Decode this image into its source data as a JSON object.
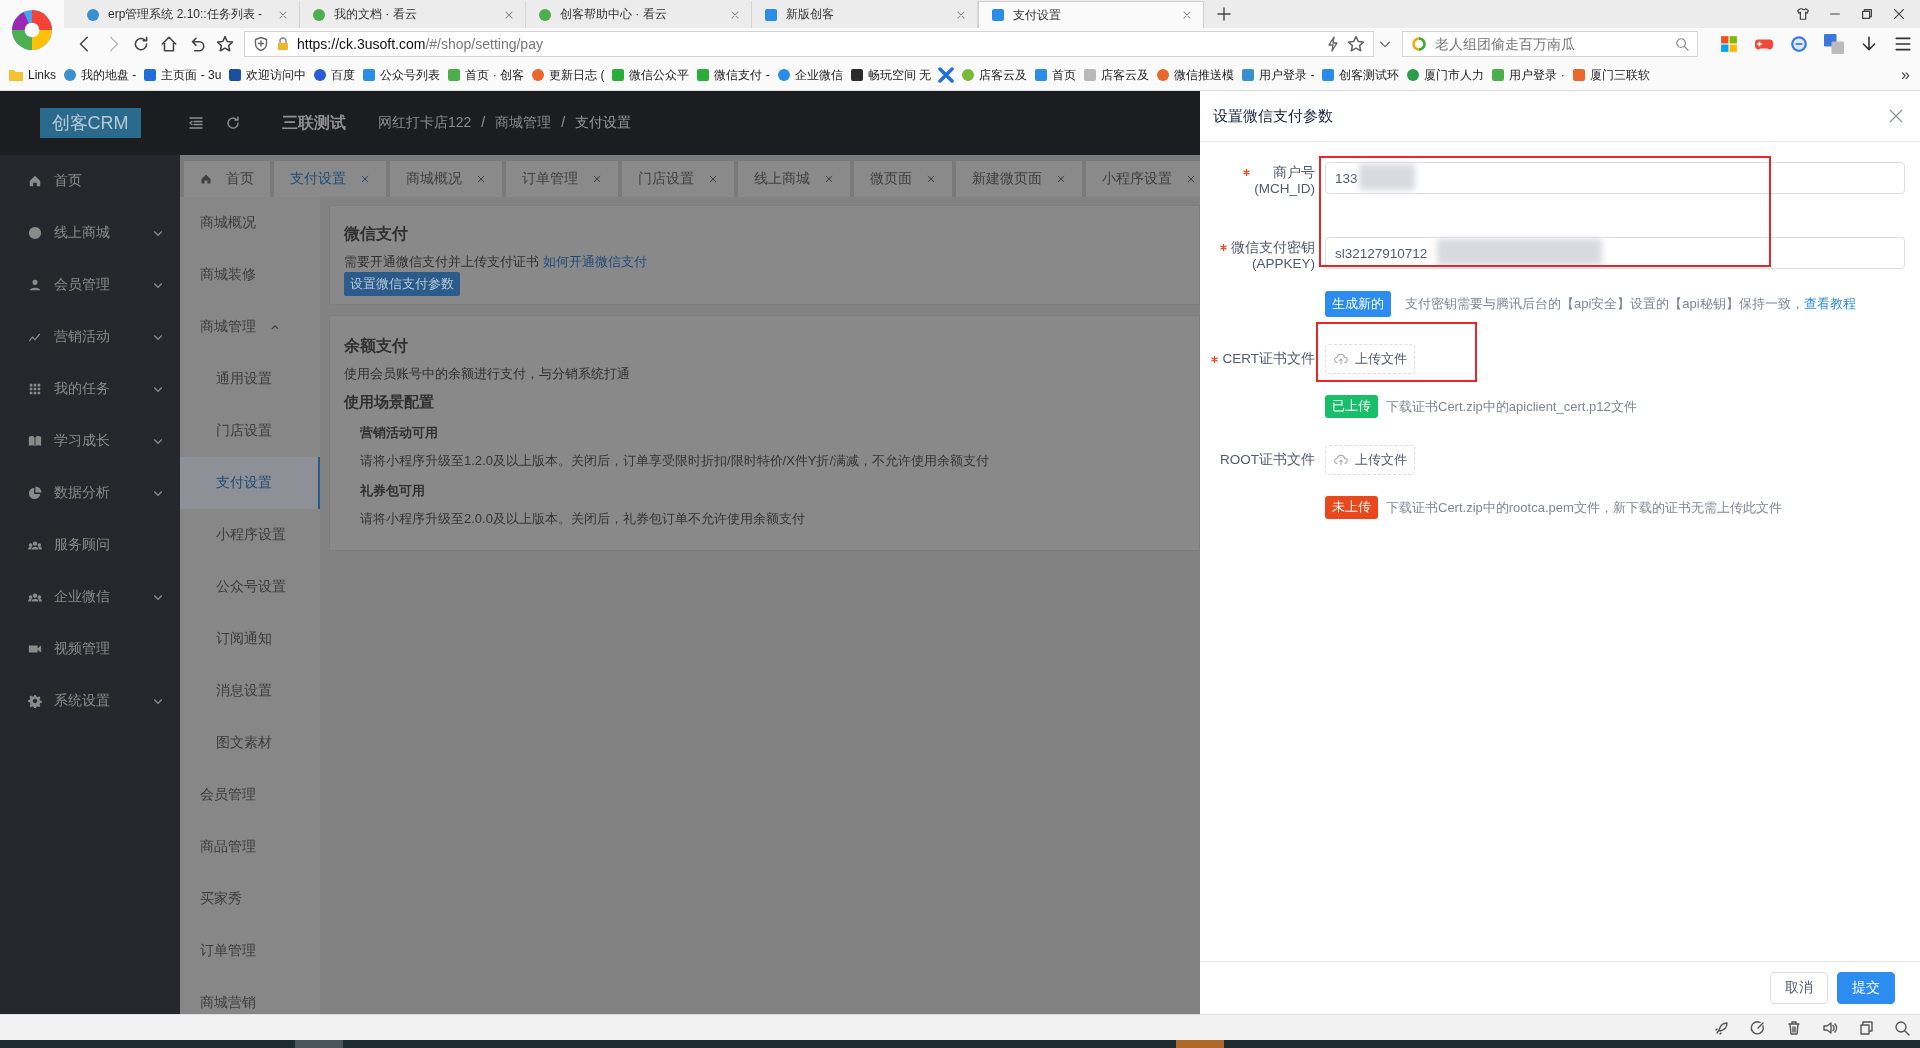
{
  "browser": {
    "tabs": [
      {
        "title": "erp管理系统 2.10::任务列表 -",
        "selected": false
      },
      {
        "title": "我的文档 · 看云",
        "selected": false
      },
      {
        "title": "创客帮助中心 · 看云",
        "selected": false
      },
      {
        "title": "新版创客",
        "selected": false
      },
      {
        "title": "支付设置",
        "selected": true
      }
    ],
    "address": {
      "host": "https://ck.3usoft.com",
      "path": "/#/shop/setting/pay"
    },
    "search": {
      "placeholder": "老人组团偷走百万南瓜"
    },
    "bookmarks": [
      {
        "kind": "folder",
        "title": "Links"
      },
      {
        "kind": "link",
        "title": "我的地盘 -"
      },
      {
        "kind": "link",
        "title": "主页面 - 3u"
      },
      {
        "kind": "link",
        "title": "欢迎访问中"
      },
      {
        "kind": "link",
        "title": "百度"
      },
      {
        "kind": "link",
        "title": "公众号列表"
      },
      {
        "kind": "link",
        "title": "首页 · 创客"
      },
      {
        "kind": "link",
        "title": "更新日志 ("
      },
      {
        "kind": "link",
        "title": "微信公众平"
      },
      {
        "kind": "link",
        "title": "微信支付 -"
      },
      {
        "kind": "link",
        "title": "企业微信"
      },
      {
        "kind": "link",
        "title": "畅玩空间 无"
      },
      {
        "kind": "icon_only"
      },
      {
        "kind": "link",
        "title": "店客云及"
      },
      {
        "kind": "link",
        "title": "首页"
      },
      {
        "kind": "link",
        "title": "店客云及"
      },
      {
        "kind": "link",
        "title": "微信推送模"
      },
      {
        "kind": "link",
        "title": "用户登录 -"
      },
      {
        "kind": "link",
        "title": "创客测试环"
      },
      {
        "kind": "link",
        "title": "厦门市人力"
      },
      {
        "kind": "link",
        "title": "用户登录 ·"
      },
      {
        "kind": "link",
        "title": "厦门三联软"
      }
    ],
    "more": "»"
  },
  "app": {
    "logo": "创客CRM",
    "store": "三联测试",
    "breadcrumb": [
      "网红打卡店122",
      "商城管理",
      "支付设置"
    ],
    "breadcrumb_separator": "/",
    "sidebar": [
      {
        "label": "首页",
        "kind": "link"
      },
      {
        "label": "线上商城",
        "kind": "group"
      },
      {
        "label": "会员管理",
        "kind": "group"
      },
      {
        "label": "营销活动",
        "kind": "group"
      },
      {
        "label": "我的任务",
        "kind": "group"
      },
      {
        "label": "学习成长",
        "kind": "group"
      },
      {
        "label": "数据分析",
        "kind": "group"
      },
      {
        "label": "服务顾问",
        "kind": "link"
      },
      {
        "label": "企业微信",
        "kind": "group"
      },
      {
        "label": "视频管理",
        "kind": "link"
      },
      {
        "label": "系统设置",
        "kind": "group"
      }
    ],
    "page_tabs": [
      {
        "label": "首页",
        "kind": "home",
        "selected": false
      },
      {
        "label": "支付设置",
        "kind": "closable",
        "selected": true
      },
      {
        "label": "商城概况",
        "kind": "closable",
        "selected": false
      },
      {
        "label": "订单管理",
        "kind": "closable",
        "selected": false
      },
      {
        "label": "门店设置",
        "kind": "closable",
        "selected": false
      },
      {
        "label": "线上商城",
        "kind": "closable",
        "selected": false
      },
      {
        "label": "微页面",
        "kind": "closable",
        "selected": false
      },
      {
        "label": "新建微页面",
        "kind": "closable",
        "selected": false
      },
      {
        "label": "小程序设置",
        "kind": "closable",
        "selected": false
      }
    ],
    "submenu": [
      {
        "label": "商城概况",
        "selected": false
      },
      {
        "label": "商城装修",
        "selected": false
      },
      {
        "label": "商城管理",
        "expanded": true,
        "children": [
          {
            "label": "通用设置",
            "selected": false
          },
          {
            "label": "门店设置",
            "selected": false
          },
          {
            "label": "支付设置",
            "selected": true
          },
          {
            "label": "小程序设置",
            "selected": false
          },
          {
            "label": "公众号设置",
            "selected": false
          },
          {
            "label": "订阅通知",
            "selected": false
          },
          {
            "label": "消息设置",
            "selected": false
          },
          {
            "label": "图文素材",
            "selected": false
          }
        ]
      },
      {
        "label": "会员管理",
        "selected": false
      },
      {
        "label": "商品管理",
        "selected": false
      },
      {
        "label": "买家秀",
        "selected": false
      },
      {
        "label": "订单管理",
        "selected": false
      },
      {
        "label": "商城营销",
        "selected": false
      }
    ],
    "wechat_card": {
      "title": "微信支付",
      "description": "需要开通微信支付并上传支付证书",
      "link": "如何开通微信支付",
      "button": "设置微信支付参数"
    },
    "balance_card": {
      "title": "余额支付",
      "description": "使用会员账号中的余额进行支付，与分销系统打通",
      "subtitle": "使用场景配置",
      "options": [
        {
          "title": "营销活动可用",
          "description": "请将小程序升级至1.2.0及以上版本。关闭后，订单享受限时折扣/限时特价/X件Y折/满减，不允许使用余额支付"
        },
        {
          "title": "礼券包可用",
          "description": "请将小程序升级至2.0.0及以上版本。关闭后，礼券包订单不允许使用余额支付"
        }
      ]
    }
  },
  "drawer": {
    "title": "设置微信支付参数",
    "fields": [
      {
        "label": "商户号",
        "sublabel": "(MCH_ID)",
        "required": true,
        "value": "133",
        "redacted": true
      },
      {
        "label": "微信支付密钥",
        "sublabel": "(APPKEY)",
        "required": true,
        "value": "sl32127910712",
        "redacted": true
      }
    ],
    "generate": {
      "button": "生成新的",
      "hint": "支付密钥需要与腾讯后台的【api安全】设置的【api秘钥】保持一致，",
      "link": "查看教程"
    },
    "uploads": [
      {
        "label": "CERT证书文件",
        "required": true,
        "button": "上传文件",
        "status": {
          "kind": "uploaded",
          "label": "已上传"
        },
        "hint": "下载证书Cert.zip中的apiclient_cert.p12文件",
        "highlighted": true
      },
      {
        "label": "ROOT证书文件",
        "required": false,
        "button": "上传文件",
        "status": {
          "kind": "missing",
          "label": "未上传"
        },
        "hint": "下载证书Cert.zip中的rootca.pem文件，新下载的证书无需上传此文件",
        "highlighted": false
      }
    ],
    "cancel": "取消",
    "submit": "提交"
  }
}
